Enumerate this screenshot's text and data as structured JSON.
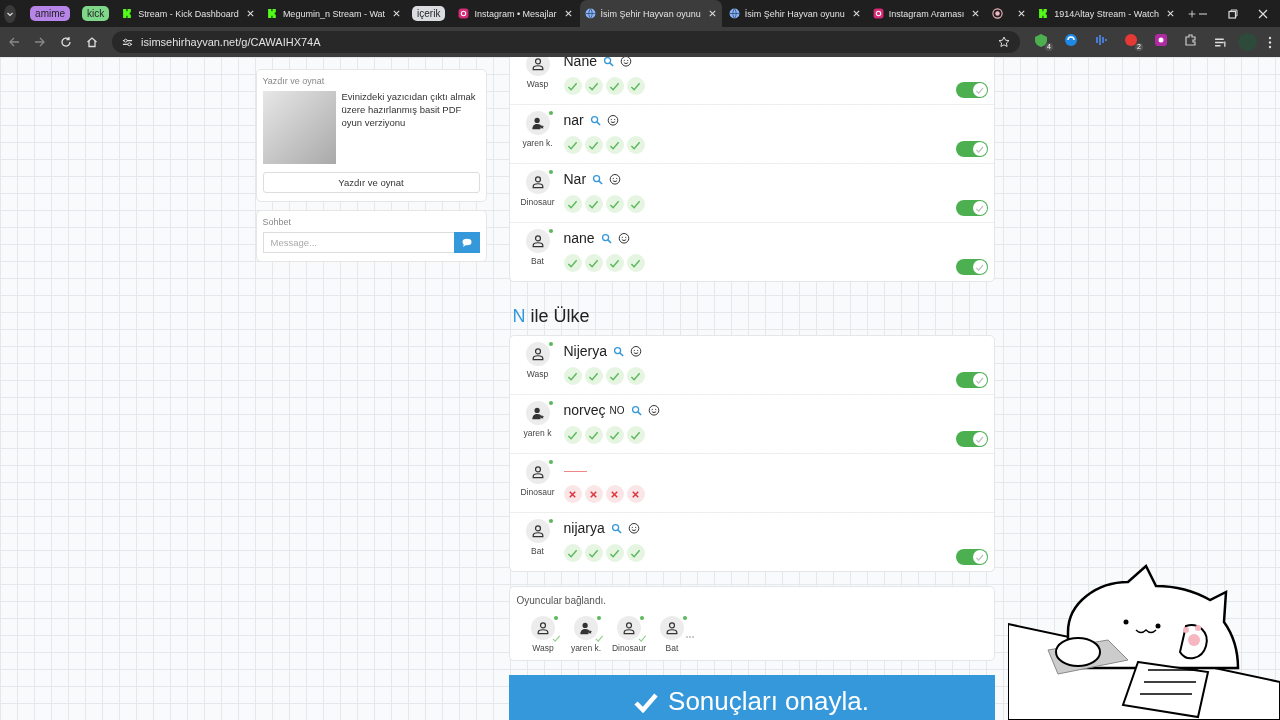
{
  "browser": {
    "tabs": [
      {
        "kind": "group",
        "label": "amime",
        "color": "#b784e8"
      },
      {
        "kind": "group",
        "label": "kick",
        "color": "#7fd88a"
      },
      {
        "kind": "kick",
        "label": "Stream - Kick Dashboard",
        "selected": false
      },
      {
        "kind": "kick",
        "label": "Megumin_n Stream - Wat",
        "selected": false
      },
      {
        "kind": "group",
        "label": "içerik",
        "color": "#dadce0"
      },
      {
        "kind": "instagram",
        "label": "Instagram • Mesajlar",
        "selected": false
      },
      {
        "kind": "globe",
        "label": "İsim Şehir Hayvan oyunu",
        "selected": true
      },
      {
        "kind": "globe",
        "label": "İsim Şehir Hayvan oyunu",
        "selected": false
      },
      {
        "kind": "instagram",
        "label": "Instagram Araması",
        "selected": false
      },
      {
        "kind": "media",
        "selected": false
      },
      {
        "kind": "kick",
        "label": "1914Altay Stream - Watch",
        "selected": false
      }
    ],
    "address": "isimsehirhayvan.net/g/CAWAIHX74A",
    "extensions": [
      {
        "kind": "shield",
        "badge": "4"
      },
      {
        "kind": "swirl"
      },
      {
        "kind": "sound"
      },
      {
        "kind": "red",
        "badge": "2"
      },
      {
        "kind": "chat"
      },
      {
        "kind": "puzzle"
      }
    ]
  },
  "sidebar": {
    "print_card": {
      "title": "Yazdır ve oynat",
      "description": "Evinizdeki yazıcıdan çıktı almak üzere hazırlanmış basit PDF oyun verziyonu",
      "button": "Yazdır ve oynat"
    },
    "chat": {
      "title": "Sohbet",
      "placeholder": "Message..."
    }
  },
  "sections": [
    {
      "answers": [
        {
          "player": "Wasp",
          "kind": "user",
          "answer": "Nane",
          "votes": [
            true,
            true,
            true,
            true
          ],
          "accepted": true
        },
        {
          "player": "yaren k.",
          "kind": "host",
          "online": true,
          "answer": "nar",
          "votes": [
            true,
            true,
            true,
            true
          ],
          "accepted": true
        },
        {
          "player": "Dinosaur",
          "kind": "user",
          "online": true,
          "answer": "Nar",
          "votes": [
            true,
            true,
            true,
            true
          ],
          "accepted": true
        },
        {
          "player": "Bat",
          "kind": "user",
          "online": true,
          "answer": "nane",
          "votes": [
            true,
            true,
            true,
            true
          ],
          "accepted": true
        }
      ]
    },
    {
      "letter": "N",
      "title": "ile Ülke",
      "answers": [
        {
          "player": "Wasp",
          "kind": "user",
          "online": true,
          "answer": "Nijerya",
          "votes": [
            true,
            true,
            true,
            true
          ],
          "accepted": true
        },
        {
          "player": "yaren k",
          "kind": "host",
          "online": true,
          "answer": "norveç",
          "tag": "NO",
          "votes": [
            true,
            true,
            true,
            true
          ],
          "accepted": true
        },
        {
          "player": "Dinosaur",
          "kind": "user",
          "online": true,
          "votes": [
            false,
            false,
            false,
            false
          ]
        },
        {
          "player": "Bat",
          "kind": "user",
          "online": true,
          "answer": "nijarya",
          "votes": [
            true,
            true,
            true,
            true
          ],
          "accepted": true
        }
      ]
    }
  ],
  "players_panel": {
    "title": "Oyuncular bağlandı.",
    "players": [
      {
        "name": "Wasp",
        "kind": "user",
        "online": true,
        "done": true
      },
      {
        "name": "yaren k.",
        "kind": "host",
        "online": true,
        "done": true
      },
      {
        "name": "Dinosaur",
        "kind": "user",
        "online": true,
        "done": true
      },
      {
        "name": "Bat",
        "kind": "user",
        "online": true,
        "done": false
      }
    ]
  },
  "confirm_button": "Sonuçları onayla."
}
